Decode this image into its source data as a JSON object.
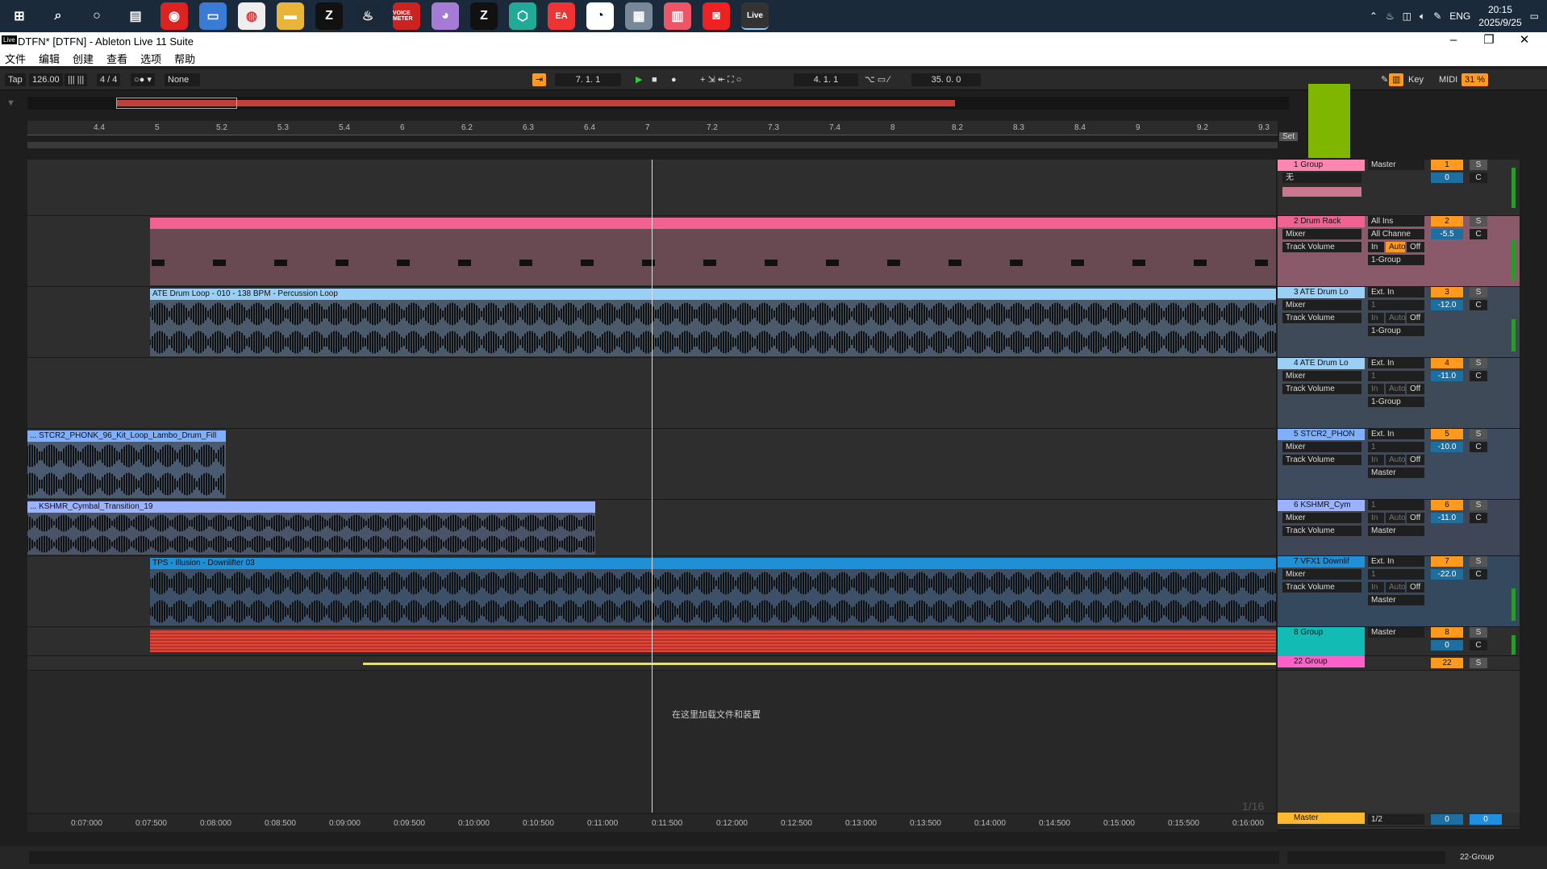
{
  "taskbar": {
    "icons": [
      "windows-icon",
      "search-icon",
      "cortana-icon",
      "taskview-icon",
      "netease-music-icon",
      "files-icon",
      "chrome-icon",
      "explorer-icon",
      "z-app-icon",
      "steam-icon",
      "voicemeeter-icon",
      "cat-app-icon",
      "z-app2-icon",
      "hex-app-icon",
      "ea-icon",
      "qq-icon",
      "server-icon",
      "music-app-icon",
      "podcast-icon",
      "ableton-live-icon"
    ],
    "voicemeeter_label": "VOICE METER",
    "live_label": "Live",
    "lang": "ENG",
    "time": "20:15",
    "date": "2025/9/25"
  },
  "window": {
    "title": "DTFN*  [DTFN] - Ableton Live 11 Suite",
    "logo": "Live",
    "minimize": "–",
    "restore": "❐",
    "close": "✕"
  },
  "menu": [
    "文件",
    "编辑",
    "创建",
    "查看",
    "选项",
    "帮助"
  ],
  "control_bar": {
    "tap": "Tap",
    "tempo": "126.00",
    "time_signature": "4 / 4",
    "quantize": "None",
    "arrangement_position": "7.   1.   1",
    "loop_start": "4.   1.   1",
    "loop_length": "35.   0.   0",
    "key": "Key",
    "midi": "MIDI",
    "cpu": "31 %",
    "follow_icon": "arrow-icon",
    "pencil_icon": "pencil-icon",
    "indicator": "1/16"
  },
  "ruler_marks": [
    "4.4",
    "5",
    "5.2",
    "5.3",
    "5.4",
    "6",
    "6.2",
    "6.3",
    "6.4",
    "7",
    "7.2",
    "7.3",
    "7.4",
    "8",
    "8.2",
    "8.3",
    "8.4",
    "9",
    "9.2",
    "9.3"
  ],
  "set_label": "Set",
  "empty_hint": "在这里加载文件和装置",
  "timeline_marks": [
    "0:07:000",
    "0:07:500",
    "0:08:000",
    "0:08:500",
    "0:09:000",
    "0:09:500",
    "0:10:000",
    "0:10:500",
    "0:11:000",
    "0:11:500",
    "0:12:000",
    "0:12:500",
    "0:13:000",
    "0:13:500",
    "0:14:000",
    "0:14:500",
    "0:15:000",
    "0:15:500",
    "0:16:000"
  ],
  "clips": [
    {
      "name": "ATE Drum Loop - 010 - 138 BPM - Percussion Loop",
      "color": "#9ad0f5"
    },
    {
      "name": "... STCR2_PHONK_96_Kit_Loop_Lambo_Drum_Fill",
      "color": "#7fb0ff"
    },
    {
      "name": "... KSHMR_Cymbal_Transition_19",
      "color": "#9ab2ff"
    },
    {
      "name": "TPS - Illusion - Downlifter 03",
      "color": "#1f8fd6"
    }
  ],
  "tracks": [
    {
      "name": "1 Group",
      "color": "#ff86b0",
      "route_in": "无",
      "io": "Master",
      "num": "1",
      "vol": "0",
      "pan": "C",
      "solo": "S"
    },
    {
      "name": "2 Drum Rack",
      "color": "#ff86b0",
      "device": "Mixer",
      "param": "Track Volume",
      "io_in": "All Ins",
      "io_ch": "All Channe",
      "io_out": "1-Group",
      "num": "2",
      "vol": "-5.5",
      "pan": "C",
      "solo": "S",
      "monitor": [
        "In",
        "Auto",
        "Off"
      ]
    },
    {
      "name": "3 ATE Drum Lo",
      "color": "#9ad0f5",
      "device": "Mixer",
      "param": "Track Volume",
      "io_in": "Ext. In",
      "io_ch": "1",
      "io_out": "1-Group",
      "num": "3",
      "vol": "-12.0",
      "pan": "C",
      "solo": "S",
      "monitor": [
        "In",
        "Auto",
        "Off"
      ]
    },
    {
      "name": "4 ATE Drum Lo",
      "color": "#9ad0f5",
      "device": "Mixer",
      "param": "Track Volume",
      "io_in": "Ext. In",
      "io_ch": "1",
      "io_out": "1-Group",
      "num": "4",
      "vol": "-11.0",
      "pan": "C",
      "solo": "S",
      "monitor": [
        "In",
        "Auto",
        "Off"
      ]
    },
    {
      "name": "5 STCR2_PHON",
      "color": "#7fb0ff",
      "device": "Mixer",
      "param": "Track Volume",
      "io_in": "Ext. In",
      "io_ch": "1",
      "io_out": "Master",
      "num": "5",
      "vol": "-10.0",
      "pan": "C",
      "solo": "S",
      "monitor": [
        "In",
        "Auto",
        "Off"
      ]
    },
    {
      "name": "6 KSHMR_Cym",
      "color": "#9ab2ff",
      "device": "Mixer",
      "param": "Track Volume",
      "io_in": "1",
      "io_ch": "",
      "io_out": "Master",
      "num": "6",
      "vol": "-11.0",
      "pan": "C",
      "solo": "S",
      "monitor": [
        "In",
        "Auto",
        "Off"
      ]
    },
    {
      "name": "7 VFX1 Downlif",
      "color": "#1f8fd6",
      "device": "Mixer",
      "param": "Track Volume",
      "io_in": "Ext. In",
      "io_ch": "1",
      "io_out": "Master",
      "num": "7",
      "vol": "-22.0",
      "pan": "C",
      "solo": "S",
      "monitor": [
        "In",
        "Auto",
        "Off"
      ]
    },
    {
      "name": "8 Group",
      "color": "#12bbb4",
      "io": "Master",
      "num": "8",
      "vol": "0",
      "pan": "C",
      "solo": "S"
    },
    {
      "name": "22 Group",
      "color": "#ff5fc8",
      "num": "22",
      "solo": "S"
    }
  ],
  "master": {
    "name": "Master",
    "route": "1/2",
    "vol": "0",
    "pan": "0",
    "color": "#ffb830"
  },
  "bottom": {
    "group_label": "22-Group"
  }
}
